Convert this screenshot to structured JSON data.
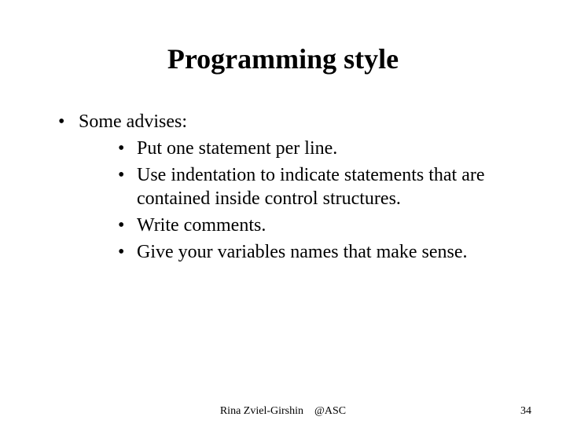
{
  "title": "Programming style",
  "bullets": {
    "lead": "Some advises:",
    "items": [
      "Put one statement per line.",
      "Use indentation to indicate statements that are contained inside control structures.",
      "Write comments.",
      "Give your variables names that make sense."
    ]
  },
  "footer": {
    "author": "Rina Zviel-Girshin",
    "org": "@ASC",
    "page": "34"
  }
}
